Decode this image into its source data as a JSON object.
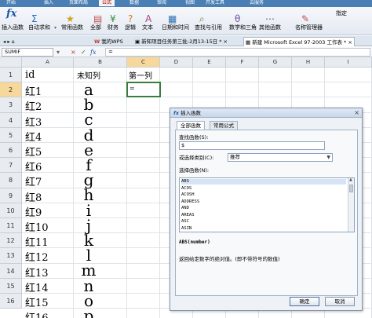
{
  "menubar": {
    "items": [
      "开始",
      "插入",
      "页面布局",
      "公式",
      "数据",
      "审阅",
      "视图",
      "开发工具",
      "云服务"
    ],
    "active_index": 3
  },
  "ribbon": {
    "insert_function": "插入函数",
    "autosum": "自动求和",
    "common_functions": "常用函数",
    "all": "全部",
    "finance": "财务",
    "logic": "逻辑",
    "text": "文本",
    "datetime": "日期和时间",
    "lookup": "查找与引用",
    "math": "数学和三角",
    "other": "其他函数",
    "name_manager": "名称管理器",
    "specify": "指定"
  },
  "tabs": {
    "my_wps": "我的WPS",
    "doc1": "新知项目任务第三批-2月13-15日",
    "doc2": "新建 Microsoft Excel 97-2003 工作表",
    "close_glyph": "×",
    "mark": "*"
  },
  "formula_bar": {
    "name_box": "SUMIF",
    "cancel": "×",
    "confirm": "✓",
    "fx": "fx",
    "content": "="
  },
  "grid": {
    "columns": [
      "A",
      "B",
      "C",
      "D",
      "E",
      "F",
      "G",
      "H",
      "I"
    ],
    "selected_column": "C",
    "rows": [
      "1",
      "2",
      "3",
      "4",
      "5",
      "6",
      "7",
      "8",
      "9",
      "10",
      "11",
      "12",
      "13",
      "14",
      "15",
      "16"
    ],
    "selected_row": "2",
    "header_a": "id",
    "header_b": "未知列",
    "header_c": "第一列",
    "ids": [
      "红1",
      "红2",
      "红3",
      "红4",
      "红5",
      "红6",
      "红7",
      "红8",
      "红9",
      "红10",
      "红11",
      "红12",
      "红13",
      "红14",
      "红15",
      "红16"
    ],
    "letters": [
      "a",
      "b",
      "c",
      "d",
      "e",
      "f",
      "g",
      "h",
      "i",
      "j",
      "k",
      "l",
      "m",
      "n",
      "o",
      "p"
    ],
    "active_cell_value": "="
  },
  "dialog": {
    "title": "插入函数",
    "close": "×",
    "tab_all": "全部函数",
    "tab_common": "常用公式",
    "search_label": "查找函数(S):",
    "search_value": "$",
    "category_label": "或选择类别(C):",
    "category_value": "推荐",
    "select_label": "选择函数(N):",
    "functions": [
      "ABS",
      "ACOS",
      "ACOSH",
      "ADDRESS",
      "AND",
      "AREAS",
      "ASC",
      "ASIN"
    ],
    "selected_function_index": 0,
    "signature": "ABS(number)",
    "description": "返回给定数字的绝对值。(即不带符号的数值)",
    "ok": "确定",
    "cancel": "取消"
  },
  "colors": {
    "menubar": "#4a7fb5",
    "selection_header": "#f7d89a",
    "active_cell_border": "#3a7d3a",
    "dialog_bg": "#eef1f6"
  }
}
